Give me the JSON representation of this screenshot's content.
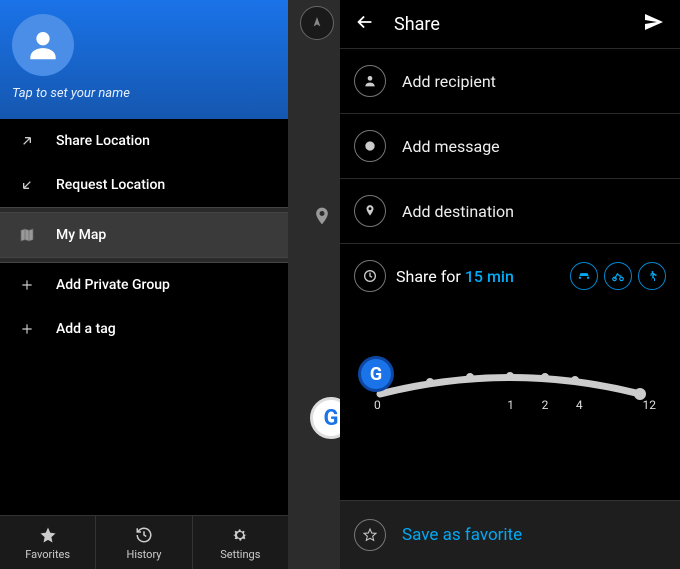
{
  "profile": {
    "tap_to_set": "Tap to set your name"
  },
  "menu": {
    "share_location": "Share Location",
    "request_location": "Request Location",
    "my_map": "My Map",
    "add_private_group": "Add Private Group",
    "add_tag": "Add a tag"
  },
  "bottom": {
    "favorites": "Favorites",
    "history": "History",
    "settings": "Settings"
  },
  "share": {
    "title": "Share",
    "add_recipient": "Add recipient",
    "add_message": "Add message",
    "add_destination": "Add destination",
    "share_for_prefix": "Share for ",
    "share_for_value": "15 min",
    "slider": {
      "l0": "0",
      "l1": "1",
      "l2": "2",
      "l4": "4",
      "l12": "12"
    },
    "save_favorite": "Save as favorite"
  }
}
